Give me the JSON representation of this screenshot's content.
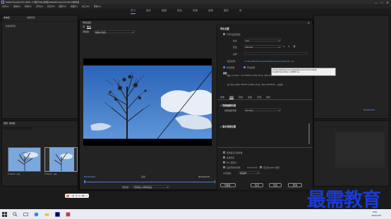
{
  "app": {
    "title": "Adobe Premiere Pro 2020 - C:\\用户\\Sky\\文档\\Adobe\\Premiere Pro\\14.0\\未命名",
    "menu": [
      "文件(F)",
      "编辑(E)",
      "剪辑(C)",
      "序列(S)",
      "标记(M)",
      "图形(G)",
      "视图(V)",
      "窗口(W)",
      "帮助(H)"
    ],
    "workspaces": [
      "学习",
      "组件",
      "编辑",
      "颜色",
      "效果",
      "音频",
      "图形",
      "库"
    ],
    "active_workspace": "学习",
    "window_controls": [
      "—",
      "□",
      "✕"
    ]
  },
  "left_panels": {
    "top_tabs": [
      "未命名",
      "效果控件"
    ],
    "sub_tab": "未选择剪辑",
    "bottom_tab": "项目: 未命名",
    "clips": [
      {
        "label": "C:\\Users\\...\\.jpg"
      },
      {
        "label": "C:\\Users\\...\\.jpg"
      }
    ]
  },
  "dialog": {
    "title": "导出设置",
    "close": "✕",
    "tabs": [
      "源",
      "输出"
    ],
    "source_scale_label": "源缩放:",
    "source_scale_value": "缩放以适合",
    "timecode_in": "00;00;00;00",
    "timecode_out": "00;00;04;29",
    "fit": "适合",
    "range_label": "源范围:",
    "range_value": "序列切入/序列切出",
    "export_settings": {
      "header": "导出设置",
      "match_sequence": "与序列设置匹配",
      "format_label": "格式:",
      "format_value": "AVI",
      "preset_label": "预设:",
      "preset_value": "PAL DV",
      "comment_label": "注释:",
      "output_name_label": "输出名称:",
      "output_name_value": "C:\\Users\\Sky\\Documents\\Adobe\\Premiere Pro\\14.0\\...avi",
      "export_video": "导出视频",
      "export_audio": "导出音频",
      "summary_title": "摘要",
      "summary_output": "输出: C:\\Users\\...\\.avi  720x576 (1.094), 25 fps, 下场, 00;00;05;00 ...",
      "summary_source": "源: 序列, 序列01  720x576 (1.0940), 25 fps, 下场, 00;00;05;00 ...  无音频"
    },
    "tabs_row": [
      "效果",
      "视频",
      "音频",
      "多路",
      "字幕",
      "发布"
    ],
    "active_tab": "视频",
    "video_codec_header": "✓ 视频编解码器",
    "video_codec_label": "视频编解码器:",
    "video_codec_value": "DV PAL",
    "basic_settings_header": "✓ 基本视频设置",
    "options": {
      "max_depth": "使用最高渲染质量",
      "use_previews": "使用预览",
      "import_project": "导入项目中",
      "set_start_tc": "设置开始时间码",
      "start_tc_value": "00;00;00;00",
      "render_alpha": "仅渲染 Alpha 通道",
      "time_interp_label": "时间插值:",
      "time_interp_value": "帧采样"
    },
    "buttons": {
      "metadata": "元数据...",
      "queue": "队列",
      "export": "导出",
      "cancel": "取消"
    },
    "tooltip": "C:\\Users\\Sky\\Documents\\Adobe\\Premiere Pro\\14.0\\序列01.avi\\C:\\Users\\Sky\\...1234567.avi"
  },
  "right_panels": {
    "timecode": "00;00;02;13",
    "timecode2": "00;00;04;29"
  },
  "ime_bar": [
    "中",
    "°",
    "简",
    "半",
    "⚙",
    "⌨",
    "☺"
  ],
  "watermark": "最需教育",
  "taskbar": {
    "time": "9:52",
    "date": "2021/1/15"
  }
}
